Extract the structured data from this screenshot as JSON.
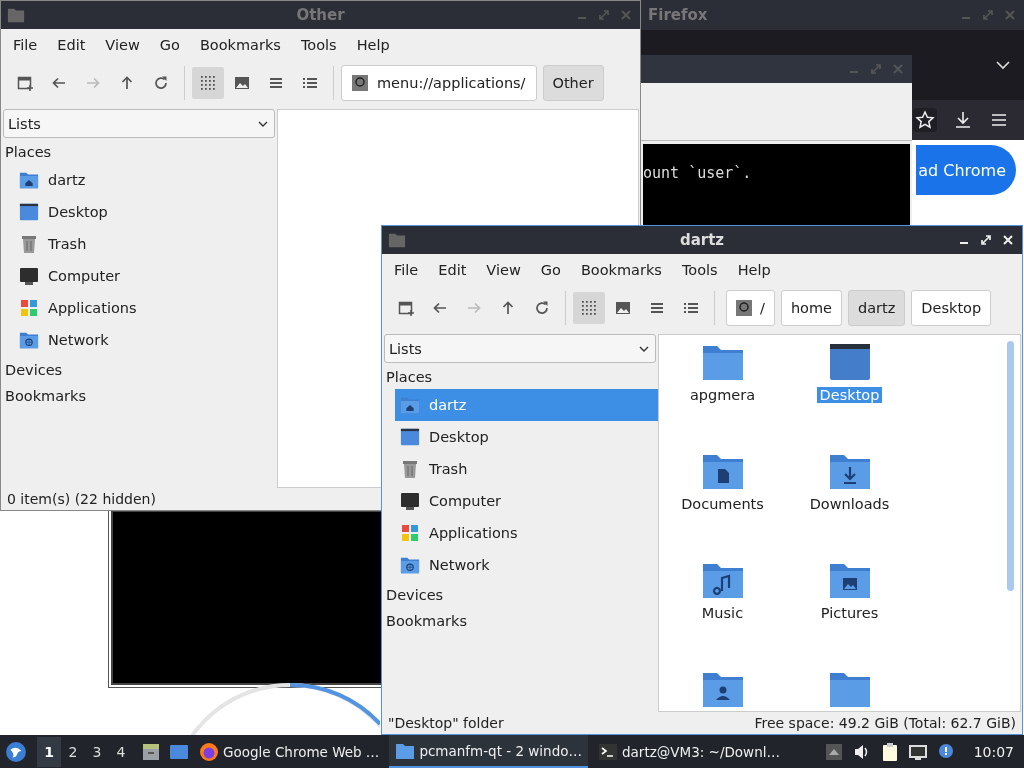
{
  "firefox": {
    "title": "Firefox",
    "page_button": "ad Chrome"
  },
  "terminal": {
    "output": "ount `user`."
  },
  "file_windows": [
    {
      "title": "Other",
      "active": false,
      "menu": [
        "File",
        "Edit",
        "View",
        "Go",
        "Bookmarks",
        "Tools",
        "Help"
      ],
      "toolbar": [
        {
          "kind": "new-window",
          "disabled": false,
          "selected": false
        },
        {
          "kind": "back",
          "disabled": false,
          "selected": false
        },
        {
          "kind": "forward",
          "disabled": true,
          "selected": false
        },
        {
          "kind": "up",
          "disabled": false,
          "selected": false
        },
        {
          "kind": "reload",
          "disabled": false,
          "selected": false
        },
        {
          "kind": "icon-view",
          "disabled": false,
          "selected": true
        },
        {
          "kind": "thumbnail-view",
          "disabled": false,
          "selected": false
        },
        {
          "kind": "compact-view",
          "disabled": false,
          "selected": false
        },
        {
          "kind": "detailed-view",
          "disabled": false,
          "selected": false
        }
      ],
      "path": [
        {
          "kind": "address",
          "label": "menu://applications/",
          "selected": false
        },
        {
          "kind": "crumb",
          "label": "Other",
          "selected": true
        }
      ],
      "sidebar": {
        "mode": "Lists",
        "sections": [
          {
            "label": "Places",
            "items": [
              {
                "kind": "home",
                "label": "dartz",
                "selected": false
              },
              {
                "kind": "desktop",
                "label": "Desktop",
                "selected": false
              },
              {
                "kind": "trash",
                "label": "Trash",
                "selected": false
              },
              {
                "kind": "computer",
                "label": "Computer",
                "selected": false
              },
              {
                "kind": "applications",
                "label": "Applications",
                "selected": false
              },
              {
                "kind": "network",
                "label": "Network",
                "selected": false
              }
            ]
          },
          {
            "label": "Devices"
          },
          {
            "label": "Bookmarks"
          }
        ]
      },
      "status": {
        "left": "0 item(s) (22 hidden)"
      }
    },
    {
      "title": "dartz",
      "active": true,
      "menu": [
        "File",
        "Edit",
        "View",
        "Go",
        "Bookmarks",
        "Tools",
        "Help"
      ],
      "toolbar": [
        {
          "kind": "new-window",
          "disabled": false,
          "selected": false
        },
        {
          "kind": "back",
          "disabled": false,
          "selected": false
        },
        {
          "kind": "forward",
          "disabled": true,
          "selected": false
        },
        {
          "kind": "up",
          "disabled": false,
          "selected": false
        },
        {
          "kind": "reload",
          "disabled": false,
          "selected": false
        },
        {
          "kind": "icon-view",
          "disabled": false,
          "selected": true
        },
        {
          "kind": "thumbnail-view",
          "disabled": false,
          "selected": false
        },
        {
          "kind": "compact-view",
          "disabled": false,
          "selected": false
        },
        {
          "kind": "detailed-view",
          "disabled": false,
          "selected": false
        }
      ],
      "path": [
        {
          "kind": "root",
          "label": "/",
          "selected": false
        },
        {
          "kind": "crumb",
          "label": "home",
          "selected": false
        },
        {
          "kind": "crumb",
          "label": "dartz",
          "selected": true
        },
        {
          "kind": "crumb",
          "label": "Desktop",
          "selected": false
        }
      ],
      "sidebar": {
        "mode": "Lists",
        "sections": [
          {
            "label": "Places",
            "items": [
              {
                "kind": "home",
                "label": "dartz",
                "selected": true
              },
              {
                "kind": "desktop",
                "label": "Desktop",
                "selected": false
              },
              {
                "kind": "trash",
                "label": "Trash",
                "selected": false
              },
              {
                "kind": "computer",
                "label": "Computer",
                "selected": false
              },
              {
                "kind": "applications",
                "label": "Applications",
                "selected": false
              },
              {
                "kind": "network",
                "label": "Network",
                "selected": false
              }
            ]
          },
          {
            "label": "Devices"
          },
          {
            "label": "Bookmarks"
          }
        ]
      },
      "files": [
        {
          "kind": "folder",
          "label": "apgmera",
          "selected": false
        },
        {
          "kind": "desktop",
          "label": "Desktop",
          "selected": true
        },
        {
          "kind": "documents",
          "label": "Documents",
          "selected": false
        },
        {
          "kind": "downloads",
          "label": "Downloads",
          "selected": false
        },
        {
          "kind": "music",
          "label": "Music",
          "selected": false
        },
        {
          "kind": "pictures",
          "label": "Pictures",
          "selected": false
        },
        {
          "kind": "public",
          "selected": false
        },
        {
          "kind": "folder",
          "selected": false
        }
      ],
      "status": {
        "left": "\"Desktop\" folder",
        "right": "Free space: 49.2 GiB (Total: 62.7 GiB)"
      }
    }
  ],
  "taskbar": {
    "workspaces": [
      {
        "label": "1",
        "selected": true
      },
      {
        "label": "2",
        "selected": false
      },
      {
        "label": "3",
        "selected": false
      },
      {
        "label": "4",
        "selected": false
      }
    ],
    "tasks": [
      {
        "kind": "firefox",
        "label": "Google Chrome Web …",
        "selected": false
      },
      {
        "kind": "file-manager",
        "label": "pcmanfm-qt - 2 windo…",
        "selected": true
      },
      {
        "kind": "terminal",
        "label": "dartz@VM3: ~/Downl…",
        "selected": false
      }
    ],
    "clock": "10:07"
  }
}
